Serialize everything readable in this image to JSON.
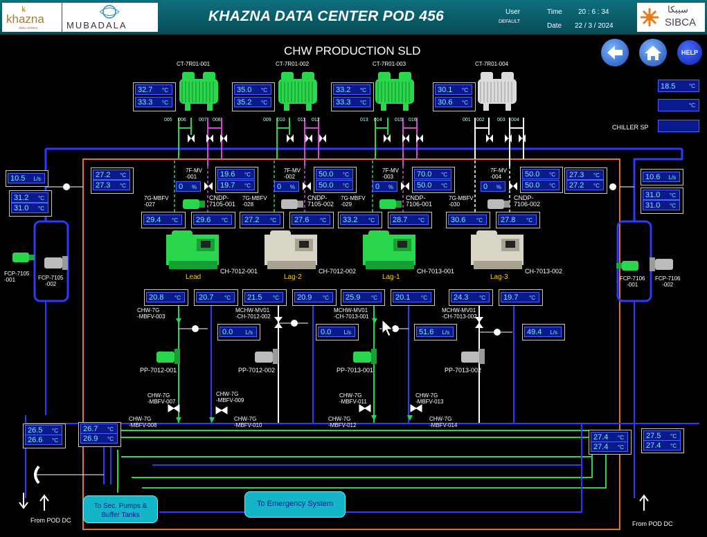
{
  "header": {
    "logo_left": "khazna",
    "logo_left_sub": "data centers",
    "logo_mid": "MUBADALA",
    "title": "KHAZNA DATA CENTER POD 456",
    "user_label": "User",
    "user_value": "DEFAULT",
    "time_label": "Time",
    "time_value": "20 : 6 : 34",
    "date_label": "Date",
    "date_value": "22 / 3 / 2024",
    "logo_right_ar": "سيبكا",
    "logo_right": "SIBCA"
  },
  "nav": {
    "back": "back",
    "home": "home",
    "help": "HELP"
  },
  "page_title": "CHW PRODUCTION SLD",
  "setpoints": {
    "v1": "18.5",
    "u1": "°C",
    "v2": "",
    "u2": "°C",
    "chiller_sp_label": "CHILLER SP",
    "v3": ""
  },
  "cooling_towers": [
    {
      "name": "CT-7R01-001",
      "t1": "32.7",
      "t2": "33.3",
      "unit": "°C",
      "valves": [
        "005",
        "006",
        "007",
        "008"
      ]
    },
    {
      "name": "CT-7R01-002",
      "t1": "35.0",
      "t2": "35.2",
      "unit": "°C",
      "valves": [
        "009",
        "010",
        "011",
        "012"
      ]
    },
    {
      "name": "CT-7R01-003",
      "t1": "33.2",
      "t2": "33.3",
      "unit": "°C",
      "valves": [
        "013",
        "014",
        "015",
        "016"
      ]
    },
    {
      "name": "CT-7R01-004",
      "t1": "30.1",
      "t2": "30.6",
      "unit": "°C",
      "valves": [
        "001",
        "002",
        "003",
        "004"
      ]
    }
  ],
  "chillers": [
    {
      "name": "CH-7012-001",
      "role": "Lead",
      "mbfv": "7G-MBFV\n-027",
      "fmv": "7F-MV\n-001",
      "pct": "0",
      "cndp": "CNDP-\n7105-001",
      "c1": "19.6",
      "c2": "19.7",
      "in": "29.4",
      "out": "29.6",
      "e1": "20.8",
      "e2": "20.7",
      "mchw": "CHW-7G\n-MBFV-003",
      "flow": "0.0",
      "pump": "PP-7012-001",
      "pct_unit": "%",
      "flow_unit": "L/s",
      "unit": "°C"
    },
    {
      "name": "CH-7012-002",
      "role": "Lag-2",
      "mbfv": "7G-MBFV\n-028",
      "fmv": "7F-MV\n-002",
      "pct": "0",
      "cndp": "CNDP-\n7105-002",
      "c1": "50.0",
      "c2": "50.0",
      "in": "27.2",
      "out": "27.6",
      "e1": "21.5",
      "e2": "20.9",
      "mchw": "MCHW-MV01\n-CH-7012-002",
      "flow": "0.0",
      "pump": "PP-7012-002",
      "pct_unit": "%",
      "flow_unit": "L/s",
      "unit": "°C"
    },
    {
      "name": "CH-7013-001",
      "role": "Lag-1",
      "mbfv": "7G-MBFV\n-029",
      "fmv": "7F-MV\n-003",
      "pct": "0",
      "cndp": "CNDP-\n7106-001",
      "c1": "70.0",
      "c2": "50.0",
      "in": "33.2",
      "out": "28.7",
      "e1": "25.9",
      "e2": "20.1",
      "mchw": "MCHW-MV01\n-CH-7013-001",
      "flow": "51.6",
      "pump": "PP-7013-001",
      "pct_unit": "%",
      "flow_unit": "L/s",
      "unit": "°C"
    },
    {
      "name": "CH-7013-002",
      "role": "Lag-3",
      "mbfv": "7G-MBFV\n-030",
      "fmv": "7F-MV\n-004",
      "pct": "0",
      "cndp": "CNDP-\n7106-002",
      "c1": "50.0",
      "c2": "50.0",
      "in": "30.6",
      "out": "27.8",
      "e1": "24.3",
      "e2": "19.7",
      "mchw": "MCHW-MV01\n-CH-7013-002",
      "flow": "49.4",
      "pump": "PP-7013-002",
      "pct_unit": "%",
      "flow_unit": "L/s",
      "unit": "°C"
    }
  ],
  "left": {
    "flow": "10.5",
    "flow_unit": "L/s",
    "t1": "31.2",
    "t2": "31.0",
    "box_t1": "27.2",
    "box_t2": "27.3",
    "unit": "°C",
    "fcp1": "FCP-7105\n-001",
    "fcp2": "FCP-7105\n-002",
    "bot_t1": "26.5",
    "bot_t2": "26.6",
    "bot2_t1": "26.7",
    "bot2_t2": "26.9",
    "from": "From POD DC"
  },
  "right": {
    "flow": "10.6",
    "flow_unit": "L/s",
    "t1": "31.0",
    "t2": "31.0",
    "box_t1": "27.3",
    "box_t2": "27.2",
    "unit": "°C",
    "fcp1": "FCP-7106\n-001",
    "fcp2": "FCP-7106\n-002",
    "bot_t1": "27.4",
    "bot_t2": "27.4",
    "bot2_t1": "27.5",
    "bot2_t2": "27.4",
    "from": "From POD DC"
  },
  "bottom_valves": [
    "CHW-7G\n-MBFV-007",
    "CHW-7G\n-MBFV-009",
    "CHW-7G\n-MBFV-008",
    "CHW-7G\n-MBFV-010",
    "CHW-7G\n-MBFV-011",
    "CHW-7G\n-MBFV-013",
    "CHW-7G\n-MBFV-012",
    "CHW-7G\n-MBFV-014"
  ],
  "buttons": {
    "sec_pumps": "To Sec. Pumps &\nBuffer Tanks",
    "emergency": "To Emergency System"
  }
}
